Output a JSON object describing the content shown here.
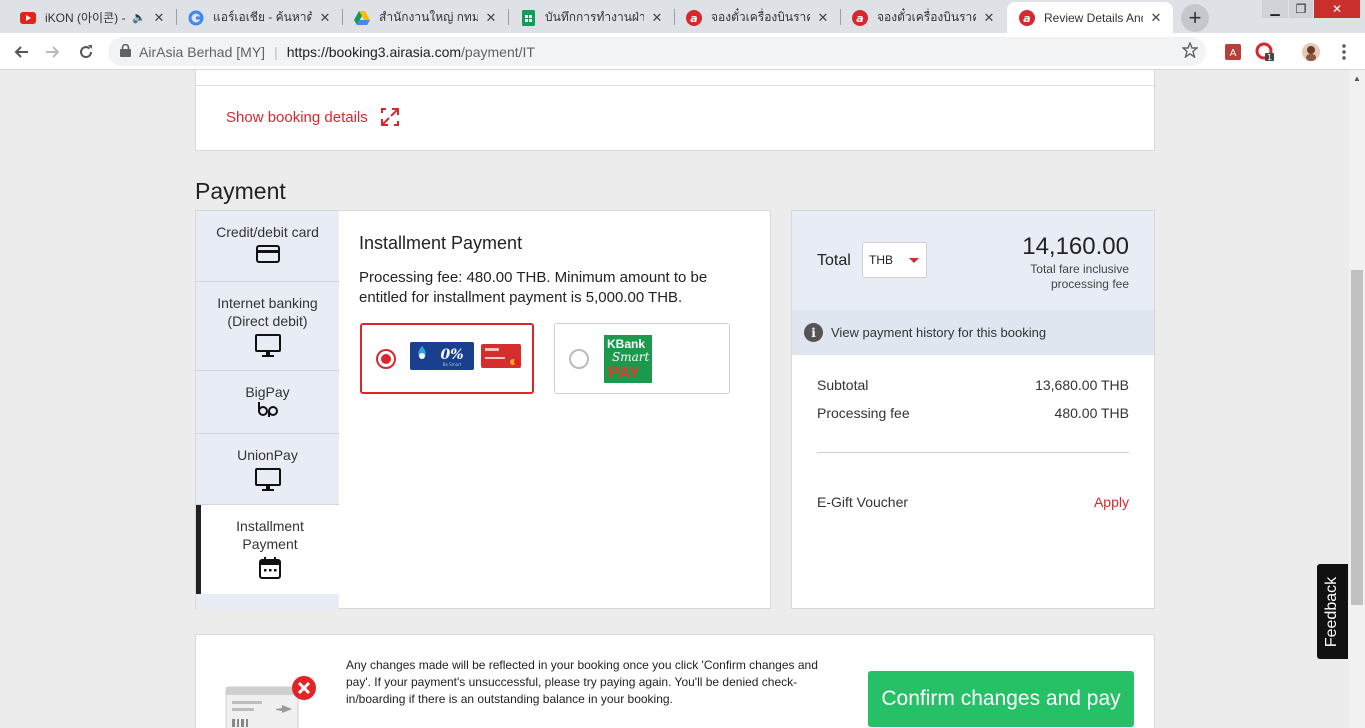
{
  "browser": {
    "tabs": [
      {
        "title": "iKON (아이콘) -",
        "favicon": "youtube-icon",
        "audio": true
      },
      {
        "title": "แอร์เอเชีย - ค้นหาด้วย",
        "favicon": "google-icon"
      },
      {
        "title": "สำนักงานใหญ่ กทม. -",
        "favicon": "google-drive-icon"
      },
      {
        "title": "บันทึกการทำงานฝ่าย S",
        "favicon": "google-sheets-icon"
      },
      {
        "title": "จองตั๋วเครื่องบินราคาถู",
        "favicon": "airasia-icon"
      },
      {
        "title": "จองตั๋วเครื่องบินราคาถู",
        "favicon": "airasia-icon"
      },
      {
        "title": "Review Details And",
        "favicon": "airasia-icon",
        "active": true
      }
    ],
    "site_identity": "AirAsia Berhad [MY]",
    "url_host": "https://booking3.airasia.com",
    "url_path": "/payment/IT",
    "extension_badge": "1"
  },
  "page": {
    "show_booking_details": "Show booking details",
    "payment_heading": "Payment",
    "methods": [
      {
        "label": "Credit/debit card",
        "icon": "credit-card-icon"
      },
      {
        "label": "Internet banking (Direct debit)",
        "icon": "monitor-icon"
      },
      {
        "label": "BigPay",
        "icon": "bigpay-icon"
      },
      {
        "label": "UnionPay",
        "icon": "monitor-icon"
      },
      {
        "label": "Installment Payment",
        "icon": "calendar-icon",
        "active": true
      }
    ],
    "installment": {
      "title": "Installment Payment",
      "description": "Processing fee: 480.00 THB. Minimum amount to be entitled for installment payment is 5,000.00 THB.",
      "options": [
        {
          "name": "Bangkok Bank 0% installment",
          "selected": true
        },
        {
          "name": "KBank Smart Pay",
          "selected": false,
          "logo_text_1": "KBank",
          "logo_text_2": "Smart",
          "logo_text_3": "PAY"
        }
      ]
    },
    "summary": {
      "total_label": "Total",
      "currency": "THB",
      "total_amount": "14,160.00",
      "total_note": "Total fare inclusive processing fee",
      "history_link": "View payment history for this booking",
      "subtotal_label": "Subtotal",
      "subtotal_value": "13,680.00 THB",
      "fee_label": "Processing fee",
      "fee_value": "480.00 THB",
      "voucher_label": "E-Gift Voucher",
      "voucher_action": "Apply"
    },
    "notice": "Any changes made will be reflected in your booking once you click 'Confirm changes and pay'. If your payment's unsuccessful, please try paying again. You'll be denied check-in/boarding if there is an outstanding balance in your booking.",
    "confirm_button": "Confirm changes and pay",
    "feedback": "Feedback"
  },
  "colors": {
    "brand_red": "#d8272f",
    "confirm_green": "#26c066",
    "panel_blue": "#e8edf5"
  }
}
